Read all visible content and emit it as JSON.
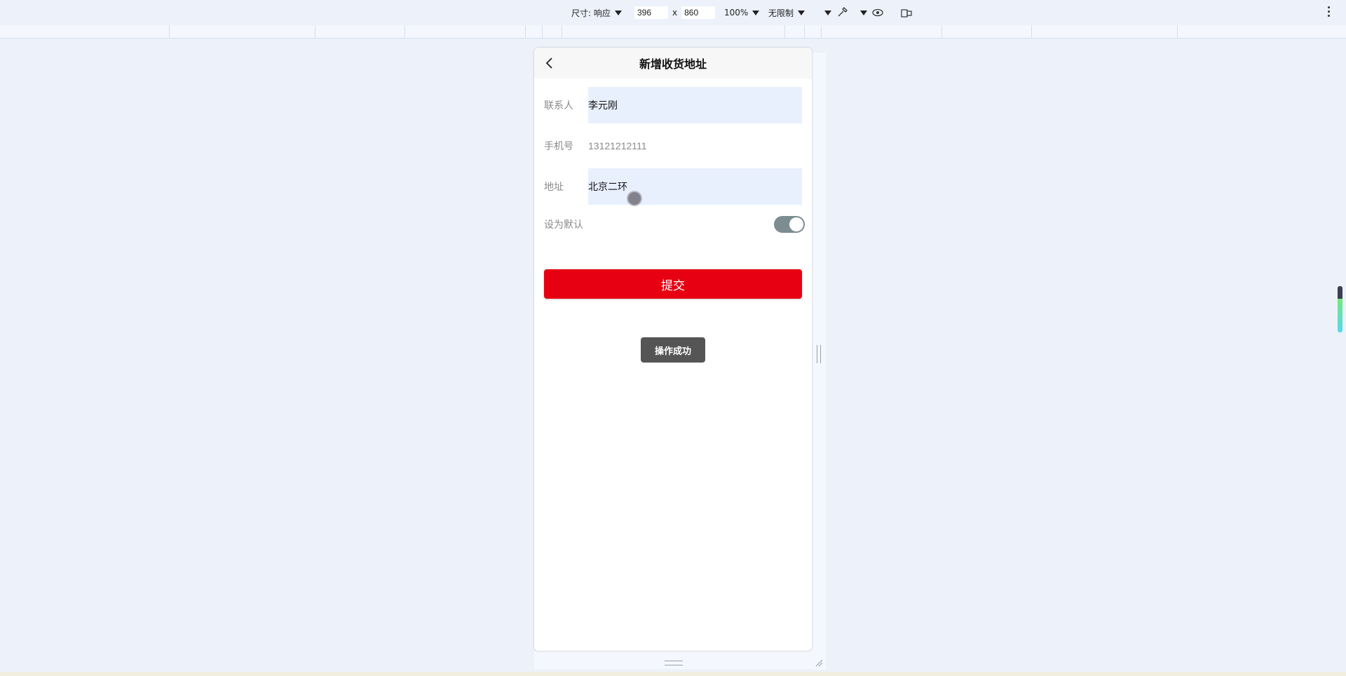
{
  "devtools": {
    "device_label": "尺寸: 响应",
    "width_value": "396",
    "height_value": "860",
    "times_sign": "x",
    "zoom_label": "100%",
    "throttle_label": "无限制"
  },
  "nav": {
    "title": "新增收货地址"
  },
  "form": {
    "contact": {
      "label": "联系人",
      "value": "李元刚"
    },
    "phone": {
      "label": "手机号",
      "value": "13121212111"
    },
    "address": {
      "label": "地址",
      "value": "北京二环"
    },
    "default": {
      "label": "设为默认",
      "enabled": true
    }
  },
  "submit_label": "提交",
  "toast_text": "操作成功",
  "colors": {
    "submit_bg": "#e60012",
    "field_bg": "#e8f0fe",
    "switch_on": "#7c8d92",
    "toast_bg": "#555555"
  }
}
